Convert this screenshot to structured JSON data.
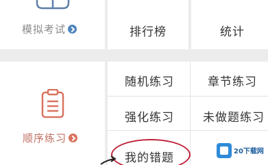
{
  "top_row": {
    "mock_exam": {
      "label": "模拟考试",
      "icon": "exam-paper-icon",
      "arrow": "arrow-right-icon"
    },
    "leaderboard_label": "排行榜",
    "statistics_label": "统计"
  },
  "sequential": {
    "label": "顺序练习",
    "icon": "clipboard-icon",
    "arrow": "arrow-right-icon"
  },
  "practice_grid": {
    "random": "随机练习",
    "chapter": "章节练习",
    "intensive": "强化练习",
    "undone": "未做题练习",
    "my_mistakes": "我的错题"
  },
  "watermark": {
    "text": "20下载网"
  },
  "colors": {
    "accent_blue": "#4f86bd",
    "accent_red": "#d9735e",
    "highlight_circle": "#c0213a",
    "background": "#ececec"
  }
}
